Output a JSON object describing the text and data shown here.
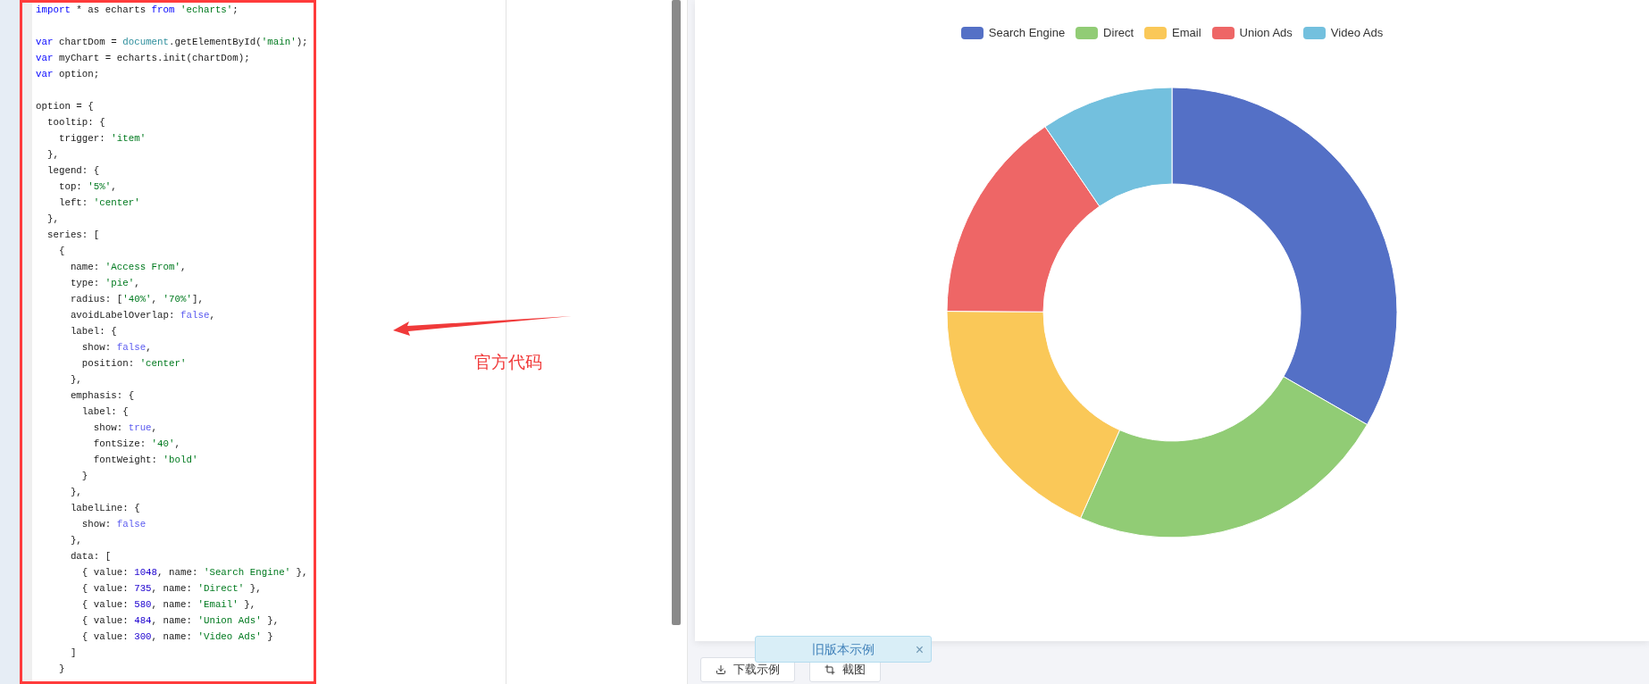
{
  "editor": {
    "blocks": [
      [
        [
          {
            "kind": "keyword",
            "text": "import"
          },
          {
            "kind": "plain",
            "text": " * as echarts "
          },
          {
            "kind": "keyword",
            "text": "from"
          },
          {
            "kind": "string",
            "text": " 'echarts'"
          },
          {
            "kind": "plain",
            "text": ";"
          }
        ]
      ],
      [
        [
          {
            "kind": "keyword",
            "text": "var"
          },
          {
            "kind": "plain",
            "text": " chartDom = "
          },
          {
            "kind": "builtin",
            "text": "document"
          },
          {
            "kind": "plain",
            "text": ".getElementById("
          },
          {
            "kind": "string",
            "text": "'main'"
          },
          {
            "kind": "plain",
            "text": ");"
          }
        ],
        [
          {
            "kind": "keyword",
            "text": "var"
          },
          {
            "kind": "plain",
            "text": " myChart = echarts.init(chartDom);"
          }
        ],
        [
          {
            "kind": "keyword",
            "text": "var"
          },
          {
            "kind": "plain",
            "text": " option;"
          }
        ]
      ],
      [
        [
          {
            "kind": "plain",
            "text": "option = {"
          }
        ],
        [
          {
            "kind": "plain",
            "text": "  tooltip: {"
          }
        ],
        [
          {
            "kind": "plain",
            "text": "    trigger: "
          },
          {
            "kind": "string",
            "text": "'item'"
          }
        ],
        [
          {
            "kind": "plain",
            "text": "  },"
          }
        ],
        [
          {
            "kind": "plain",
            "text": "  legend: {"
          }
        ],
        [
          {
            "kind": "plain",
            "text": "    top: "
          },
          {
            "kind": "string",
            "text": "'5%'"
          },
          {
            "kind": "plain",
            "text": ","
          }
        ],
        [
          {
            "kind": "plain",
            "text": "    left: "
          },
          {
            "kind": "string",
            "text": "'center'"
          }
        ],
        [
          {
            "kind": "plain",
            "text": "  },"
          }
        ],
        [
          {
            "kind": "plain",
            "text": "  series: ["
          }
        ],
        [
          {
            "kind": "plain",
            "text": "    {"
          }
        ],
        [
          {
            "kind": "plain",
            "text": "      name: "
          },
          {
            "kind": "string",
            "text": "'Access From'"
          },
          {
            "kind": "plain",
            "text": ","
          }
        ],
        [
          {
            "kind": "plain",
            "text": "      type: "
          },
          {
            "kind": "string",
            "text": "'pie'"
          },
          {
            "kind": "plain",
            "text": ","
          }
        ],
        [
          {
            "kind": "plain",
            "text": "      radius: ["
          },
          {
            "kind": "string",
            "text": "'40%'"
          },
          {
            "kind": "plain",
            "text": ", "
          },
          {
            "kind": "string",
            "text": "'70%'"
          },
          {
            "kind": "plain",
            "text": "],"
          }
        ],
        [
          {
            "kind": "plain",
            "text": "      avoidLabelOverlap: "
          },
          {
            "kind": "literal",
            "text": "false"
          },
          {
            "kind": "plain",
            "text": ","
          }
        ],
        [
          {
            "kind": "plain",
            "text": "      label: {"
          }
        ],
        [
          {
            "kind": "plain",
            "text": "        show: "
          },
          {
            "kind": "literal",
            "text": "false"
          },
          {
            "kind": "plain",
            "text": ","
          }
        ],
        [
          {
            "kind": "plain",
            "text": "        position: "
          },
          {
            "kind": "string",
            "text": "'center'"
          }
        ],
        [
          {
            "kind": "plain",
            "text": "      },"
          }
        ],
        [
          {
            "kind": "plain",
            "text": "      emphasis: {"
          }
        ],
        [
          {
            "kind": "plain",
            "text": "        label: {"
          }
        ],
        [
          {
            "kind": "plain",
            "text": "          show: "
          },
          {
            "kind": "literal",
            "text": "true"
          },
          {
            "kind": "plain",
            "text": ","
          }
        ],
        [
          {
            "kind": "plain",
            "text": "          fontSize: "
          },
          {
            "kind": "string",
            "text": "'40'"
          },
          {
            "kind": "plain",
            "text": ","
          }
        ],
        [
          {
            "kind": "plain",
            "text": "          fontWeight: "
          },
          {
            "kind": "string",
            "text": "'bold'"
          }
        ],
        [
          {
            "kind": "plain",
            "text": "        }"
          }
        ],
        [
          {
            "kind": "plain",
            "text": "      },"
          }
        ],
        [
          {
            "kind": "plain",
            "text": "      labelLine: {"
          }
        ],
        [
          {
            "kind": "plain",
            "text": "        show: "
          },
          {
            "kind": "literal",
            "text": "false"
          }
        ],
        [
          {
            "kind": "plain",
            "text": "      },"
          }
        ],
        [
          {
            "kind": "plain",
            "text": "      data: ["
          }
        ],
        [
          {
            "kind": "plain",
            "text": "        { value: "
          },
          {
            "kind": "number",
            "text": "1048"
          },
          {
            "kind": "plain",
            "text": ", name: "
          },
          {
            "kind": "string",
            "text": "'Search Engine'"
          },
          {
            "kind": "plain",
            "text": " },"
          }
        ],
        [
          {
            "kind": "plain",
            "text": "        { value: "
          },
          {
            "kind": "number",
            "text": "735"
          },
          {
            "kind": "plain",
            "text": ", name: "
          },
          {
            "kind": "string",
            "text": "'Direct'"
          },
          {
            "kind": "plain",
            "text": " },"
          }
        ],
        [
          {
            "kind": "plain",
            "text": "        { value: "
          },
          {
            "kind": "number",
            "text": "580"
          },
          {
            "kind": "plain",
            "text": ", name: "
          },
          {
            "kind": "string",
            "text": "'Email'"
          },
          {
            "kind": "plain",
            "text": " },"
          }
        ],
        [
          {
            "kind": "plain",
            "text": "        { value: "
          },
          {
            "kind": "number",
            "text": "484"
          },
          {
            "kind": "plain",
            "text": ", name: "
          },
          {
            "kind": "string",
            "text": "'Union Ads'"
          },
          {
            "kind": "plain",
            "text": " },"
          }
        ],
        [
          {
            "kind": "plain",
            "text": "        { value: "
          },
          {
            "kind": "number",
            "text": "300"
          },
          {
            "kind": "plain",
            "text": ", name: "
          },
          {
            "kind": "string",
            "text": "'Video Ads'"
          },
          {
            "kind": "plain",
            "text": " }"
          }
        ],
        [
          {
            "kind": "plain",
            "text": "      ]"
          }
        ],
        [
          {
            "kind": "plain",
            "text": "    }"
          }
        ]
      ]
    ]
  },
  "annotation": {
    "label": "官方代码"
  },
  "chart": {
    "legend": [
      {
        "color": "#5470c6"
      },
      {
        "color": "#91cc75"
      },
      {
        "color": "#fac858"
      },
      {
        "color": "#ee6666"
      },
      {
        "color": "#73c0de"
      }
    ],
    "chart_data": {
      "type": "donut",
      "legend": "top",
      "categories": [
        "Search Engine",
        "Direct",
        "Email",
        "Union Ads",
        "Video Ads"
      ],
      "values": [
        33.3,
        23.36,
        18.43,
        15.38,
        9.53
      ]
    }
  },
  "toolbar": {
    "buttons": [
      "下载示例",
      "截图"
    ]
  },
  "toast": {
    "text": "旧版本示例",
    "close": "×"
  }
}
